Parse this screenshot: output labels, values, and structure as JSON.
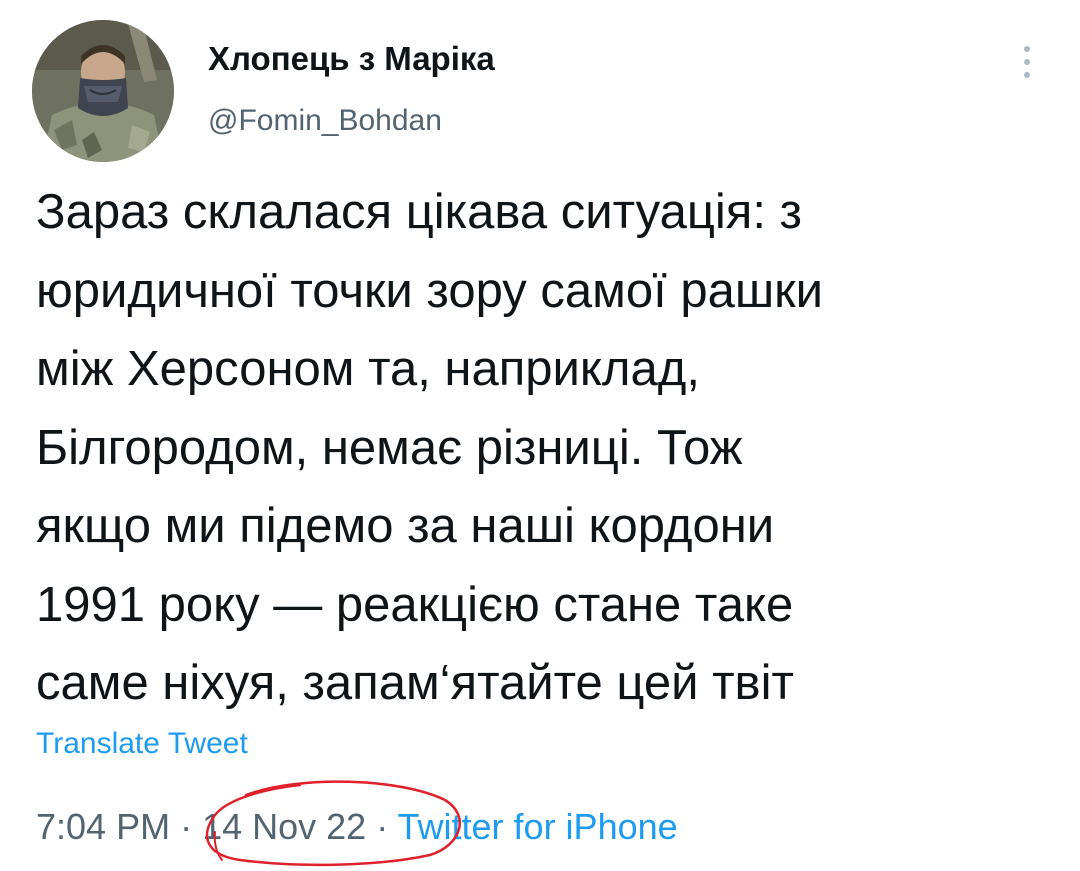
{
  "tweet": {
    "author": {
      "display_name": "Хлопець з Маріка",
      "handle": "@Fomin_Bohdan",
      "avatar": "avatar-photo"
    },
    "more_icon": "more-vertical-icon",
    "text_lines": [
      "Зараз склалася цікава ситуація: з",
      "юридичної точки зору самої рашки",
      "між Херсоном та, наприклад,",
      "Білгородом, немає різниці. Тож",
      "якщо ми підемо за наші кордони",
      "1991 року — реакцією стане таке",
      "саме ніхуя, запам‘ятайте цей твіт"
    ],
    "translate_label": "Translate Tweet",
    "meta": {
      "time": "7:04 PM",
      "separator": " · ",
      "date": "14 Nov 22",
      "source": "Twitter for iPhone"
    },
    "annotation": {
      "type": "hand-drawn circle",
      "color": "#e0202a",
      "target": "date"
    }
  },
  "colors": {
    "text": "#0f1419",
    "secondary": "#536471",
    "link": "#1d9bf0",
    "annotation": "#e0202a"
  }
}
